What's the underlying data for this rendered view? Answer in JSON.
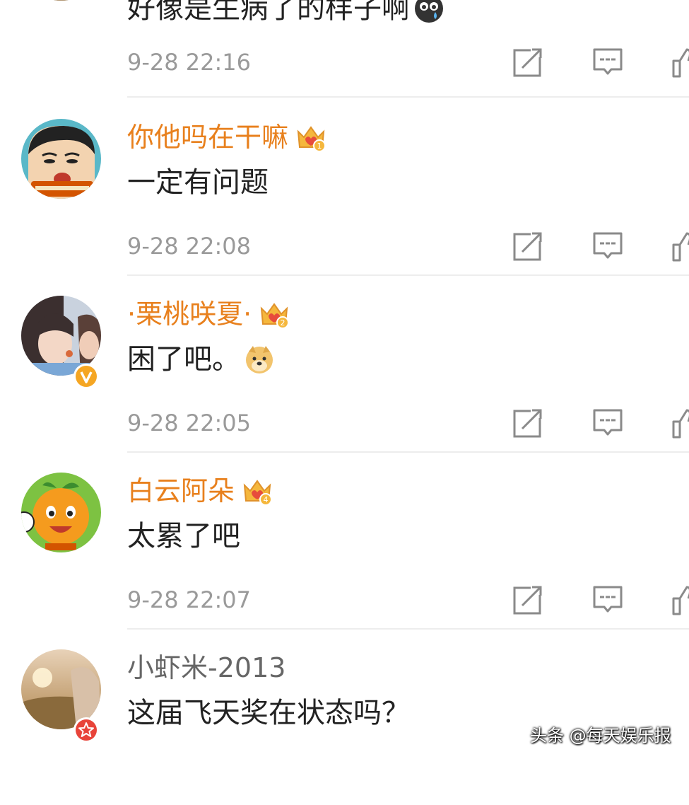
{
  "comments": [
    {
      "username": "",
      "text": "好像是生病了的样子啊",
      "time": "9-28 22:16",
      "avatar_icon": "avatar-food-icon",
      "text_emoji": "cry-face-emoji"
    },
    {
      "username": "你他吗在干嘛",
      "text": "一定有问题",
      "time": "9-28 22:08",
      "avatar_icon": "avatar-cartoon-boy-icon",
      "crown_level": "1"
    },
    {
      "username": "·栗桃咲夏·",
      "text": "困了吧。",
      "time": "9-28 22:05",
      "avatar_icon": "avatar-girl-photo-icon",
      "crown_level": "2",
      "badge": "V",
      "text_emoji": "doge-emoji"
    },
    {
      "username": "白云阿朵",
      "text": "太累了吧",
      "time": "9-28 22:07",
      "avatar_icon": "avatar-orange-cartoon-icon",
      "crown_level": "4"
    },
    {
      "username": "小虾米-2013",
      "text": "这届飞天奖在状态吗？",
      "time": "",
      "avatar_icon": "avatar-landscape-photo-icon",
      "badge": "star"
    }
  ],
  "watermark": "头条 @每天娱乐报",
  "colors": {
    "username_vip": "#e8801d",
    "username_plain": "#666666",
    "time": "#9a9a9a",
    "icon": "#8a8a8a",
    "crown": "#f5b73c"
  }
}
